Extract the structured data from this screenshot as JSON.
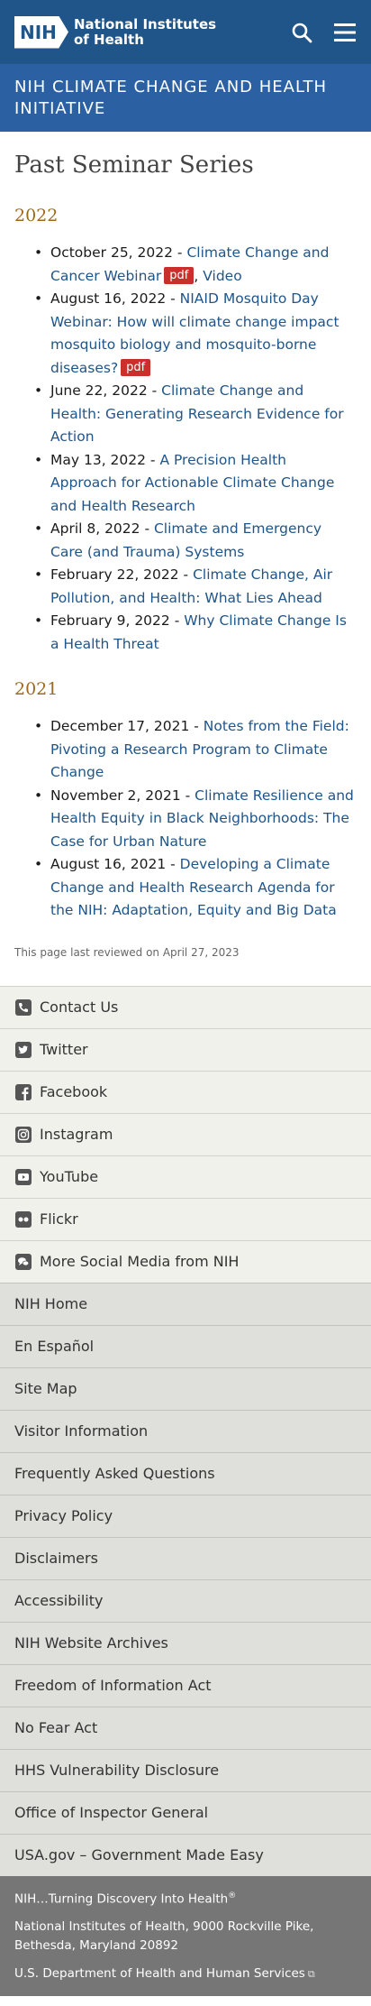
{
  "header": {
    "logo_badge": "NIH",
    "logo_line1": "National Institutes",
    "logo_line2": "of Health",
    "search_icon": "search-icon",
    "menu_icon": "hamburger-menu-icon",
    "colors": {
      "primary": "#20558a",
      "banner": "#2b61a3"
    }
  },
  "banner": {
    "title": "NIH CLIMATE CHANGE AND HEALTH INITIATIVE"
  },
  "main": {
    "title": "Past Seminar Series",
    "sections": [
      {
        "year": "2022",
        "items": [
          {
            "date": "October 25, 2022 - ",
            "link": "Climate Change and Cancer Webinar",
            "pdf": "pdf",
            "extra_sep": ", ",
            "extra": "Video"
          },
          {
            "date": "August 16, 2022 - ",
            "link": "NIAID Mosquito Day Webinar: How will climate change impact mosquito biology and mosquito-borne diseases?",
            "pdf": "pdf"
          },
          {
            "date": "June 22, 2022 - ",
            "link": "Climate Change and Health: Generating Research Evidence for Action"
          },
          {
            "date": "May 13, 2022 - ",
            "link": "A Precision Health Approach for Actionable Climate Change and Health Research"
          },
          {
            "date": "April 8, 2022 - ",
            "link": "Climate and Emergency Care (and Trauma) Systems"
          },
          {
            "date": "February 22, 2022 - ",
            "link": "Climate Change, Air Pollution, and Health: What Lies Ahead"
          },
          {
            "date": "February 9, 2022 - ",
            "link": "Why Climate Change Is a Health Threat"
          }
        ]
      },
      {
        "year": "2021",
        "items": [
          {
            "date": "December 17, 2021 - ",
            "link": "Notes from the Field: Pivoting a Research Program to Climate Change"
          },
          {
            "date": "November 2, 2021 - ",
            "link": "Climate Resilience and Health Equity in Black Neighborhoods: The Case for Urban Nature"
          },
          {
            "date": "August 16, 2021 - ",
            "link": "Developing a Climate Change and Health Research Agenda for the NIH: Adaptation, Equity and Big Data"
          }
        ]
      }
    ],
    "reviewed": "This page last reviewed on April 27, 2023"
  },
  "footer": {
    "social": [
      {
        "label": "Contact Us",
        "icon": "phone-icon"
      },
      {
        "label": "Twitter",
        "icon": "twitter-icon"
      },
      {
        "label": "Facebook",
        "icon": "facebook-icon"
      },
      {
        "label": "Instagram",
        "icon": "instagram-icon"
      },
      {
        "label": "YouTube",
        "icon": "youtube-icon"
      },
      {
        "label": "Flickr",
        "icon": "flickr-icon"
      },
      {
        "label": "More Social Media from NIH",
        "icon": "chat-bubbles-icon"
      }
    ],
    "links": [
      "NIH Home",
      "En Español",
      "Site Map",
      "Visitor Information",
      "Frequently Asked Questions",
      "Privacy Policy",
      "Disclaimers",
      "Accessibility",
      "NIH Website Archives",
      "Freedom of Information Act",
      "No Fear Act",
      "HHS Vulnerability Disclosure",
      "Office of Inspector General",
      "USA.gov – Government Made Easy"
    ],
    "tagline": "NIH…Turning Discovery Into Health",
    "tagline_mark": "®",
    "address_line1": "National Institutes of Health, 9000 Rockville Pike,",
    "address_line2": "Bethesda, Maryland 20892",
    "hhs": "U.S. Department of Health and Human Services"
  }
}
